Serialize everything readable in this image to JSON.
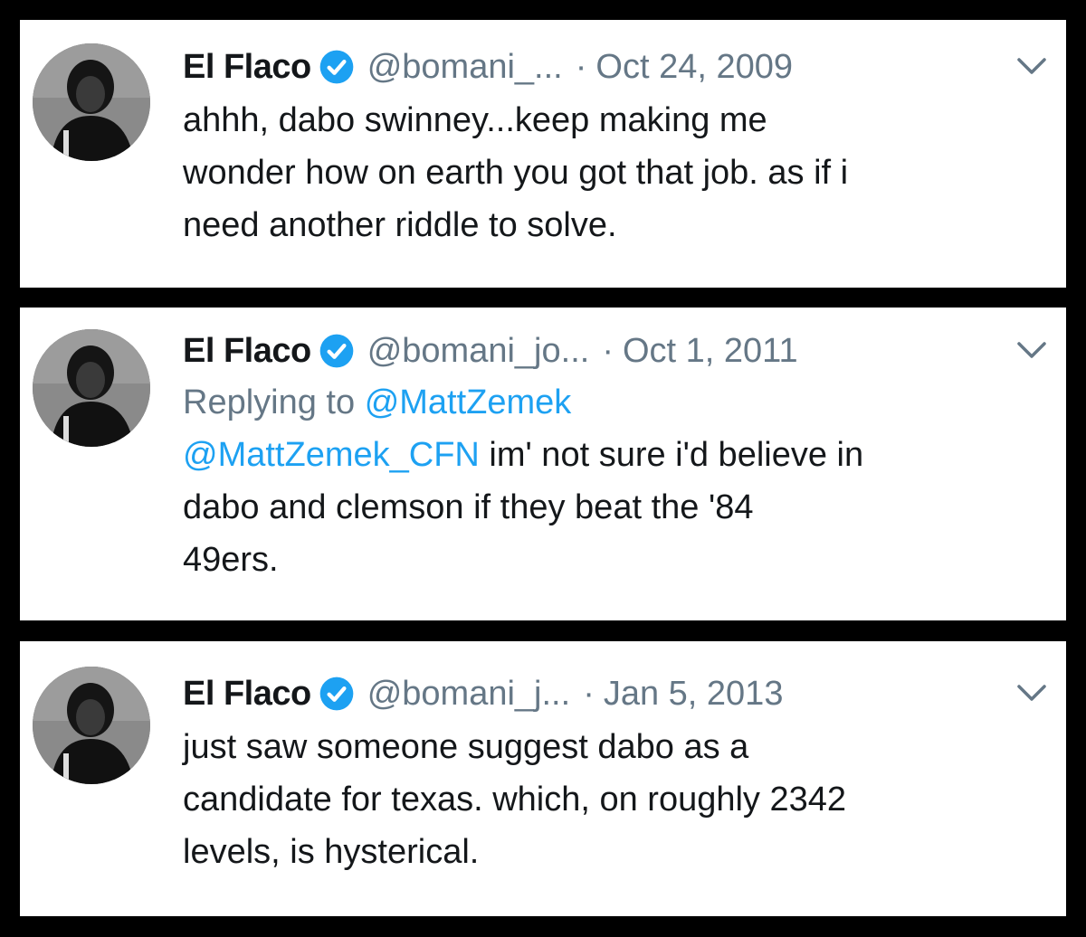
{
  "tweets": [
    {
      "display_name": "El Flaco",
      "handle": "@bomani_...",
      "separator": "·",
      "date": "Oct 24, 2009",
      "text_lines": [
        "ahhh, dabo swinney...keep making me",
        "wonder how on earth you got that job. as if i",
        "need another riddle to solve."
      ]
    },
    {
      "display_name": "El Flaco",
      "handle": "@bomani_jo...",
      "separator": "·",
      "date": "Oct 1, 2011",
      "reply_prefix": "Replying to",
      "reply_to": "@MattZemek",
      "mention": "@MattZemek_CFN",
      "text_lines": [
        " im' not sure i'd believe in",
        "dabo and clemson if they beat the '84",
        "49ers."
      ]
    },
    {
      "display_name": "El Flaco",
      "handle": "@bomani_j...",
      "separator": "·",
      "date": "Jan 5, 2013",
      "text_lines": [
        "just saw someone suggest dabo as a",
        "candidate for texas. which, on roughly 2342",
        "levels, is hysterical."
      ]
    }
  ],
  "colors": {
    "background": "#000000",
    "card": "#ffffff",
    "text": "#14171a",
    "secondary": "#657786",
    "link": "#1da1f2",
    "verified": "#1da1f2"
  },
  "icons": {
    "verified": "verified-badge-icon",
    "chevron": "chevron-down-icon"
  }
}
